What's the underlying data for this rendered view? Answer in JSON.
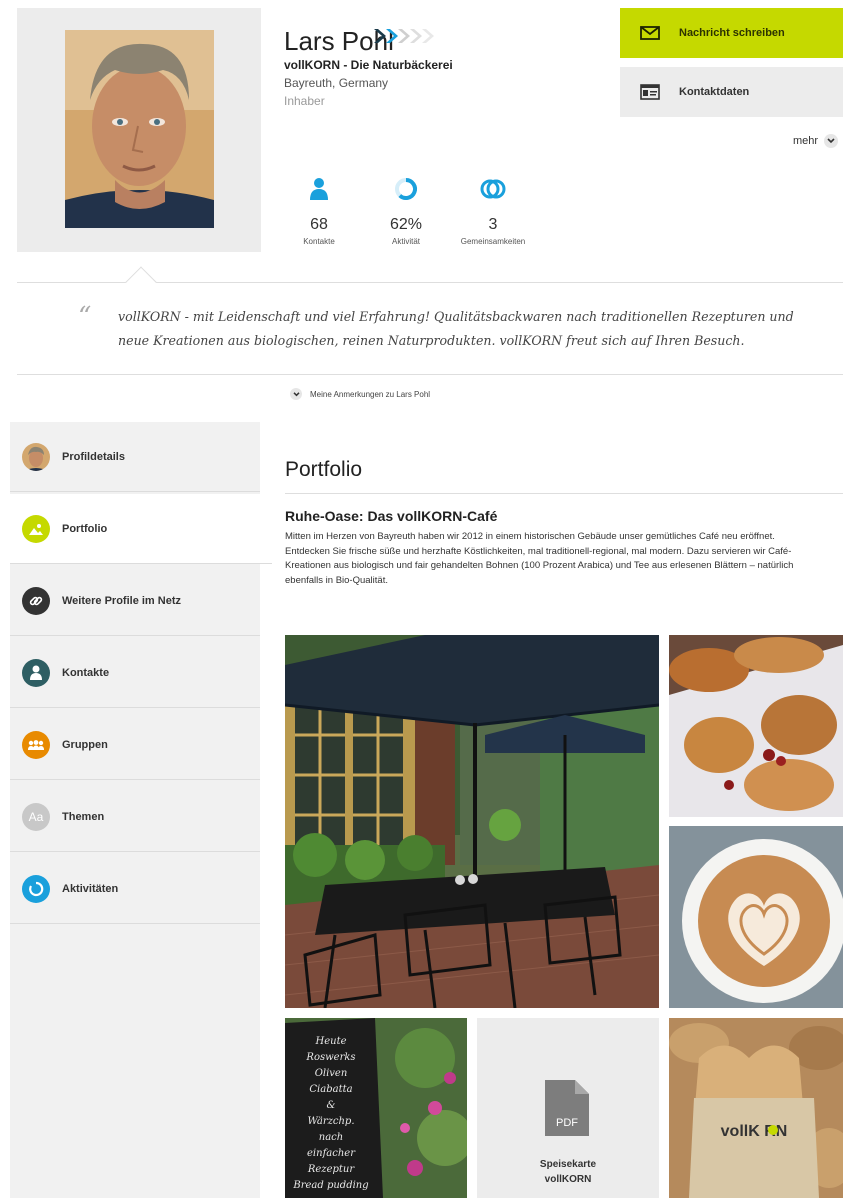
{
  "profile": {
    "name": "Lars Pohl",
    "company": "vollKORN - Die Naturbäckerei",
    "location": "Bayreuth, Germany",
    "role": "Inhaber"
  },
  "stats": [
    {
      "value": "68",
      "label": "Kontakte",
      "icon": "user-icon"
    },
    {
      "value": "62%",
      "label": "Aktivität",
      "icon": "activity-ring-icon",
      "level": 0.62
    },
    {
      "value": "3",
      "label": "Gemeinsamkeiten",
      "icon": "overlap-circles-icon"
    }
  ],
  "actions": {
    "message": "Nachricht schreiben",
    "contact": "Kontaktdaten",
    "more": "mehr"
  },
  "quote": {
    "text": "vollKORN - mit Leidenschaft und viel Erfahrung!  Qualitätsbackwaren nach traditionellen Rezepturen und neue Kreationen aus biologischen, reinen Naturprodukten. vollKORN freut sich auf Ihren Besuch."
  },
  "notes_toggle": "Meine Anmerkungen zu Lars Pohl",
  "sidebar": {
    "items": [
      {
        "label": "Profildetails",
        "icon": "profile-photo-icon",
        "color": "#c79a63"
      },
      {
        "label": "Portfolio",
        "icon": "image-icon",
        "color": "#c5d900",
        "active": true
      },
      {
        "label": "Weitere Profile im Netz",
        "icon": "link-icon",
        "color": "#333333"
      },
      {
        "label": "Kontakte",
        "icon": "user-icon",
        "color": "#2e5e63"
      },
      {
        "label": "Gruppen",
        "icon": "group-icon",
        "color": "#e88a00"
      },
      {
        "label": "Themen",
        "icon": "text-icon",
        "color": "#c8c8c8"
      },
      {
        "label": "Aktivitäten",
        "icon": "activity-icon",
        "color": "#1aa0dc"
      }
    ]
  },
  "portfolio": {
    "title": "Portfolio",
    "item_title": "Ruhe-Oase: Das vollKORN-Café",
    "item_text": "Mitten im Herzen von Bayreuth haben wir 2012 in einem historischen Gebäude unser gemütliches Café neu eröffnet. Entdecken Sie frische süße und herzhafte Köstlichkeiten, mal traditionell-regional, mal modern. Dazu servieren wir Café-Kreationen aus biologisch und fair gehandelten Bohnen (100 Prozent Arabica) und Tee aus erlesenen Blättern – natürlich ebenfalls in Bio-Qualität.",
    "pdf": {
      "badge": "PDF",
      "caption_line1": "Speisekarte",
      "caption_line2": "vollKORN"
    },
    "bag_logo": "vollK RN",
    "chalkboard_lines": [
      "Heute",
      "Roswerks",
      "Oliven",
      "Ciabatta",
      "&",
      "Wärzchp.",
      "nach",
      "einfacher",
      "Rezeptur",
      "Bread pudding"
    ]
  },
  "colors": {
    "accent": "#c5d900",
    "stat_icon": "#1aa0dc"
  }
}
